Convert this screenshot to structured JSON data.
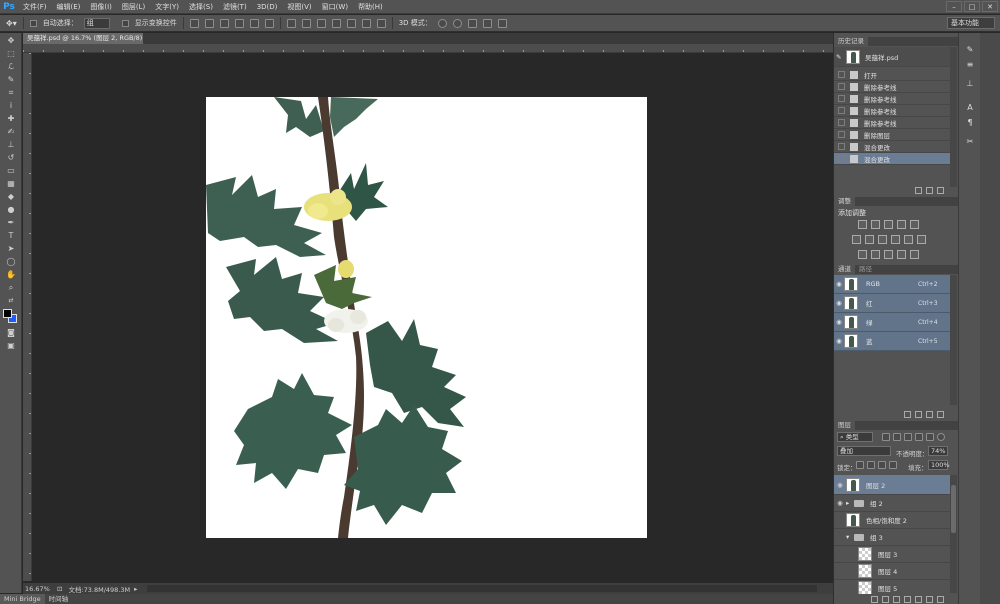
{
  "app": {
    "logo": "Ps"
  },
  "menu": [
    "文件(F)",
    "编辑(E)",
    "图像(I)",
    "图层(L)",
    "文字(Y)",
    "选择(S)",
    "滤镜(T)",
    "3D(D)",
    "视图(V)",
    "窗口(W)",
    "帮助(H)"
  ],
  "options_bar": {
    "auto_select_label": "自动选择：",
    "auto_select_value": "组",
    "show_transform_label": "显示变换控件",
    "mode_3d_label": "3D 模式：",
    "workspace": "基本功能"
  },
  "document": {
    "tab_title": "吴蕴祥.psd @ 16.7% (图层 2, RGB/8) *",
    "zoom": "16.67%",
    "doc_size": "文档:73.8M/498.3M"
  },
  "bottom_tabs": [
    "Mini Bridge",
    "时间轴"
  ],
  "history": {
    "tab": "历史记录",
    "snapshot": "吴蕴祥.psd",
    "items": [
      "打开",
      "删除参考线",
      "删除参考线",
      "删除参考线",
      "删除参考线",
      "删除图层",
      "混合更改",
      "混合更改"
    ]
  },
  "adjustments": {
    "tab": "调整",
    "title": "添加调整"
  },
  "channels": {
    "tabs": [
      "通道",
      "路径"
    ],
    "items": [
      {
        "name": "RGB",
        "shortcut": "Ctrl+2"
      },
      {
        "name": "红",
        "shortcut": "Ctrl+3"
      },
      {
        "name": "绿",
        "shortcut": "Ctrl+4"
      },
      {
        "name": "蓝",
        "shortcut": "Ctrl+5"
      }
    ]
  },
  "layers": {
    "tab": "图层",
    "filter_label": "类型",
    "blend_mode": "叠加",
    "opacity_label": "不透明度：",
    "opacity_value": "74%",
    "lock_label": "锁定：",
    "fill_label": "填充：",
    "fill_value": "100%",
    "items": [
      "图层 2",
      "组 2",
      "色相/饱和度 2",
      "组 3",
      "图层 3",
      "图层 4",
      "图层 5"
    ]
  },
  "colors": {
    "selection": "#6a7d95",
    "foreground": "#000000",
    "background": "#1e5bff",
    "leaf": "#3f5f52",
    "stem": "#4a3a30",
    "flower": "#e8e07a"
  }
}
